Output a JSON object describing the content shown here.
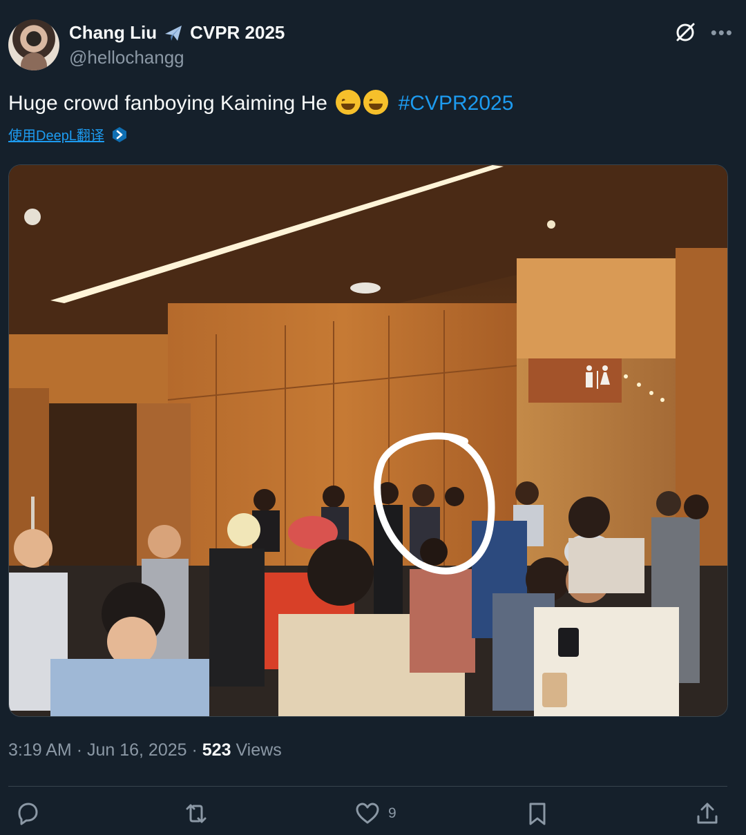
{
  "author": {
    "name": "Chang Liu",
    "badge_text": "CVPR 2025",
    "handle": "@hellochangg",
    "avatar_icon": "avatar-photo"
  },
  "header_actions": {
    "grok_icon": "grok-icon",
    "more_label": "•••"
  },
  "tweet": {
    "text": "Huge crowd fanboying Kaiming He",
    "emoji_icon": "rolling-on-floor-laughing-emoji",
    "emoji_count": 2,
    "hashtag": "#CVPR2025",
    "translate_label": "使用DeepL翻译"
  },
  "media": {
    "image_type": "photo"
  },
  "meta": {
    "time": "3:19 AM",
    "separator": "·",
    "date": "Jun 16, 2025",
    "views_count": "523",
    "views_label": "Views"
  },
  "actions": {
    "reply_count": "",
    "retweet_count": "",
    "like_count": "9",
    "bookmark_count": ""
  },
  "colors": {
    "background": "#15202b",
    "text": "#f7f9f9",
    "secondary": "#8b98a5",
    "accent": "#1d9bf0",
    "border": "#38444d"
  }
}
